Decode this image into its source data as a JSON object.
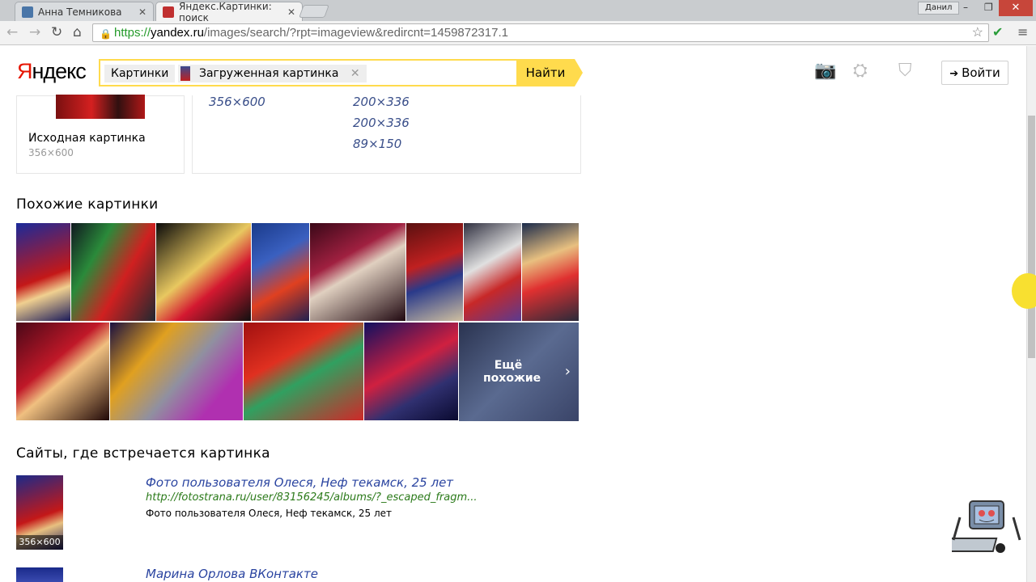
{
  "browser": {
    "tabs": [
      {
        "label": "Анна Темникова",
        "favicon_color": "#4a76a8"
      },
      {
        "label": "Яндекс.Картинки: поиск",
        "favicon_color": "#c03030"
      }
    ],
    "profile": "Данил",
    "url_secure": "https://",
    "url_host": "yandex.ru",
    "url_path": "/images/search/?rpt=imageview&redircnt=1459872317.1"
  },
  "header": {
    "logo_first": "Я",
    "logo_rest": "ндекс",
    "tag_section": "Картинки",
    "tag_image": "Загруженная картинка",
    "find_label": "Найти",
    "login_label": "Войти"
  },
  "original": {
    "label": "Исходная картинка",
    "size": "356×600"
  },
  "other_sizes": [
    "356×600",
    "200×336",
    "200×336",
    "89×150"
  ],
  "similar": {
    "title": "Похожие картинки",
    "more_label_line1": "Ещё",
    "more_label_line2": "похожие"
  },
  "sites": {
    "title": "Сайты, где встречается картинка",
    "items": [
      {
        "title": "Фото пользователя Олеся, Неф текамск, 25 лет",
        "url": "http://fotostrana.ru/user/83156245/albums/?_escaped_fragm...",
        "desc": "Фото пользователя Олеся, Неф текамск, 25 лет",
        "size": "356×600"
      },
      {
        "title": "Марина Орлова ВКонтакте"
      }
    ]
  },
  "colors": {
    "accent": "#ffdb4d",
    "logo_red": "#e61400",
    "link": "#2a44a0"
  }
}
